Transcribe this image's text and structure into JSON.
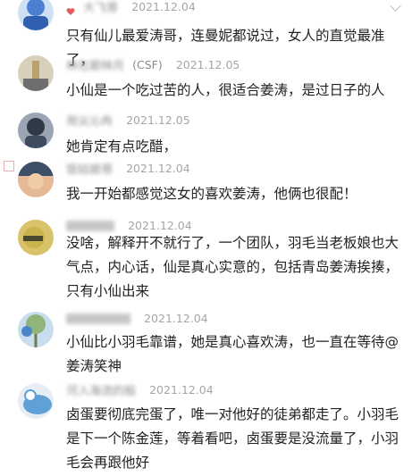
{
  "comments": [
    {
      "name": "大飞哥",
      "date": "2021.12.04",
      "text": "只有仙儿最爱涛哥，连曼妮都说过，女人的直觉最准了，",
      "avatar_colors": [
        "#4b7fd0",
        "#cfe0f6"
      ]
    },
    {
      "name": "林在颠林月",
      "name_suffix": "(CSF)",
      "date": "2021.12.05",
      "text": "小仙是一个吃过苦的人，很适合姜涛，是过日子的人",
      "avatar_colors": [
        "#b9a36c",
        "#6e6e6e"
      ]
    },
    {
      "name": "用尖沁冉",
      "date": "2021.12.05",
      "text": "她肯定有点吃醋，",
      "avatar_colors": [
        "#2e3a48",
        "#9aa6b4"
      ]
    },
    {
      "name": "饭姑娘哥",
      "date": "2021.12.04",
      "text": "我一开始都感觉这女的喜欢姜涛，他俩也很配！",
      "avatar_colors": [
        "#3c4f67",
        "#e6b996"
      ]
    },
    {
      "name": "",
      "date": "2021.12.04",
      "text": "没啥，解释开不就行了，一个团队，羽毛当老板娘也大气点，内心话，仙是真心实意的，包括青岛姜涛挨揍，只有小仙出来",
      "avatar_colors": [
        "#c9b34d",
        "#4c4a2e"
      ]
    },
    {
      "name": "",
      "date": "2021.12.04",
      "text": "小仙比小羽毛靠谱，她是真心喜欢涛，也一直在等待@姜涛笑神",
      "avatar_colors": [
        "#4a86c8",
        "#8fb57a"
      ]
    },
    {
      "name": "河入海流的船",
      "date": "2021.12.04",
      "text": "卤蛋要彻底完蛋了，唯一对他好的徒弟都走了。小羽毛是下一个陈金莲，等着看吧，卤蛋要是没流量了，小羽毛会再跟他好",
      "avatar_colors": [
        "#5fa0d6",
        "#e8edf5"
      ]
    }
  ],
  "icons": {
    "menu": "more-dots-icon",
    "expand": "chevron-down-icon"
  },
  "colors": {
    "name": "#8a8a8a",
    "date": "#a6a6a6",
    "text": "#222222",
    "icon": "#b5b5b5"
  }
}
